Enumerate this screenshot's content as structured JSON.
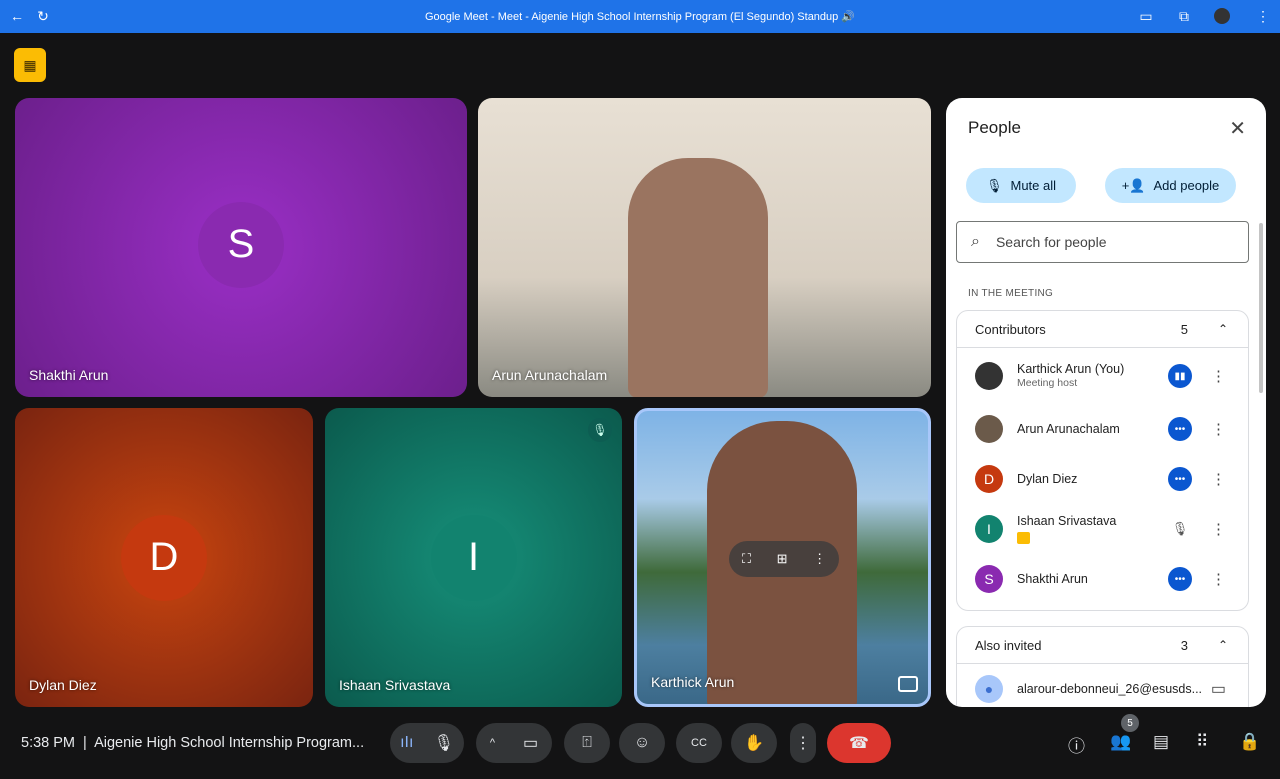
{
  "browser": {
    "title": "Google Meet - Meet - Aigenie High School Internship Program (El Segundo) Standup 🔊"
  },
  "tiles": [
    {
      "name": "Shakthi Arun",
      "initial": "S",
      "color": "#8a2ab0"
    },
    {
      "name": "Arun Arunachalam"
    },
    {
      "name": "Dylan Diez",
      "initial": "D",
      "color": "#c5390f"
    },
    {
      "name": "Ishaan Srivastava",
      "initial": "I",
      "color": "#12836f",
      "muted": true
    },
    {
      "name": "Karthick Arun"
    }
  ],
  "panel": {
    "title": "People",
    "mute_all": "Mute all",
    "add_people": "Add people",
    "search_placeholder": "Search for people",
    "section": "IN THE MEETING",
    "contributors": {
      "label": "Contributors",
      "count": "5",
      "people": [
        {
          "name": "Karthick Arun (You)",
          "sub": "Meeting host",
          "status": "speaking"
        },
        {
          "name": "Arun Arunachalam",
          "status": "more"
        },
        {
          "name": "Dylan Diez",
          "initial": "D",
          "color": "#c5390f",
          "status": "more"
        },
        {
          "name": "Ishaan Srivastava",
          "initial": "I",
          "color": "#12836f",
          "status": "muted"
        },
        {
          "name": "Shakthi Arun",
          "initial": "S",
          "color": "#8a2ab0",
          "status": "more"
        }
      ]
    },
    "also_invited": {
      "label": "Also invited",
      "count": "3",
      "people": [
        {
          "name": "alarour-debonneui_26@esusds..."
        }
      ]
    }
  },
  "bottom": {
    "time": "5:38 PM",
    "meeting": "Aigenie High School Internship Program...",
    "people_count": "5"
  }
}
